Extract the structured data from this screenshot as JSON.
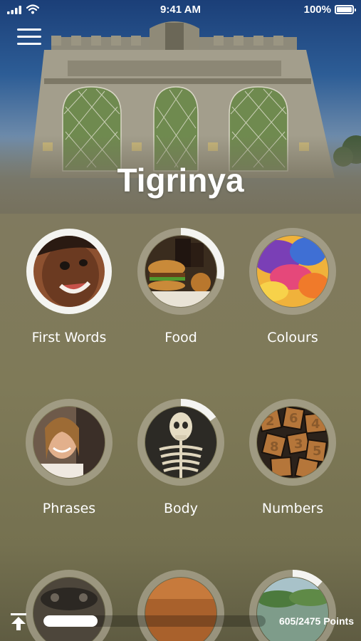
{
  "status_bar": {
    "time": "9:41 AM",
    "battery": "100%"
  },
  "header": {
    "title": "Tigrinya"
  },
  "topics": [
    {
      "label": "First Words",
      "progress": 0.88,
      "full": true
    },
    {
      "label": "Food",
      "progress": 0.28,
      "full": false
    },
    {
      "label": "Colours",
      "progress": 0,
      "full": false
    },
    {
      "label": "Phrases",
      "progress": 0,
      "full": false
    },
    {
      "label": "Body",
      "progress": 0.15,
      "full": false
    },
    {
      "label": "Numbers",
      "progress": 0,
      "full": false
    },
    {
      "label": "",
      "progress": 0,
      "full": false
    },
    {
      "label": "",
      "progress": 0,
      "full": false
    },
    {
      "label": "",
      "progress": 0.12,
      "full": false
    }
  ],
  "footer": {
    "points_label": "605/2475 Points",
    "points_earned": 605,
    "points_total": 2475
  }
}
